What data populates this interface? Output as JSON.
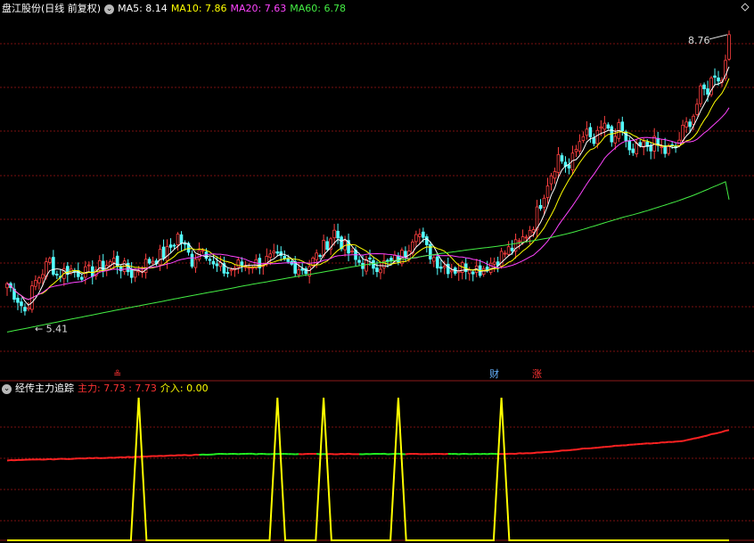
{
  "main_panel": {
    "stock_title": "盘江股份(日线 前复权)",
    "ma_legend": [
      {
        "text": "MA5: 8.14",
        "color": "#ffffff"
      },
      {
        "text": "MA10: 7.86",
        "color": "#ffff00"
      },
      {
        "text": "MA20: 7.63",
        "color": "#ff44ff"
      },
      {
        "text": "MA60: 6.78",
        "color": "#44ee44"
      }
    ],
    "high_label": "8.76",
    "low_label": "5.41",
    "markers": [
      {
        "text": "≗",
        "color": "#ff3333",
        "day": 31
      },
      {
        "text": "财",
        "color": "#66b3ff",
        "day": 137
      },
      {
        "text": "涨",
        "color": "#ff3333",
        "day": 149
      }
    ]
  },
  "indicator_panel": {
    "title": "经传主力追踪",
    "zhuli_label": "主力: 7.73 : 7.73",
    "jieru_label": "介入: 0.00",
    "colors": {
      "zhuli": "#ff3333",
      "jieru": "#ffff00"
    }
  },
  "chart_data": [
    {
      "type": "candlestick",
      "title": "盘江股份(日线 前复权)",
      "days": 204,
      "ylim": [
        4.8,
        8.95
      ],
      "price_anchors": [
        [
          0,
          5.78
        ],
        [
          3,
          5.6
        ],
        [
          5,
          5.45
        ],
        [
          8,
          5.8
        ],
        [
          12,
          6.05
        ],
        [
          14,
          5.88
        ],
        [
          17,
          5.95
        ],
        [
          22,
          5.9
        ],
        [
          25,
          5.95
        ],
        [
          30,
          6.05
        ],
        [
          35,
          5.9
        ],
        [
          40,
          6.05
        ],
        [
          45,
          6.15
        ],
        [
          48,
          6.35
        ],
        [
          52,
          6.05
        ],
        [
          55,
          6.25
        ],
        [
          58,
          5.98
        ],
        [
          62,
          5.92
        ],
        [
          65,
          6.0
        ],
        [
          70,
          6.02
        ],
        [
          75,
          6.08
        ],
        [
          80,
          6.0
        ],
        [
          84,
          5.95
        ],
        [
          88,
          6.15
        ],
        [
          92,
          6.4
        ],
        [
          95,
          6.2
        ],
        [
          98,
          6.05
        ],
        [
          102,
          6.0
        ],
        [
          108,
          6.02
        ],
        [
          112,
          6.15
        ],
        [
          115,
          6.45
        ],
        [
          118,
          6.18
        ],
        [
          122,
          6.0
        ],
        [
          126,
          5.95
        ],
        [
          130,
          6.0
        ],
        [
          133,
          5.95
        ],
        [
          137,
          6.05
        ],
        [
          140,
          6.15
        ],
        [
          144,
          6.25
        ],
        [
          148,
          6.5
        ],
        [
          152,
          7.0
        ],
        [
          155,
          7.3
        ],
        [
          158,
          7.15
        ],
        [
          162,
          7.6
        ],
        [
          165,
          7.45
        ],
        [
          168,
          7.7
        ],
        [
          170,
          7.4
        ],
        [
          172,
          7.7
        ],
        [
          175,
          7.3
        ],
        [
          178,
          7.4
        ],
        [
          182,
          7.45
        ],
        [
          185,
          7.35
        ],
        [
          188,
          7.4
        ],
        [
          190,
          7.6
        ],
        [
          193,
          7.8
        ],
        [
          195,
          8.05
        ],
        [
          197,
          8.1
        ],
        [
          199,
          8.3
        ],
        [
          201,
          8.2
        ],
        [
          203,
          8.75
        ]
      ],
      "range_high": {
        "value": 8.76,
        "day": 203
      },
      "range_low": {
        "value": 5.41,
        "day": 5
      },
      "moving_averages": [
        {
          "name": "MA5",
          "value": 8.14
        },
        {
          "name": "MA10",
          "value": 7.86
        },
        {
          "name": "MA20",
          "value": 7.63
        },
        {
          "name": "MA60",
          "value": 6.78,
          "start": 5.2
        }
      ]
    },
    {
      "type": "line",
      "title": "经传主力追踪",
      "ylim": [
        0,
        10
      ],
      "series": [
        {
          "name": "主力",
          "value": 7.73,
          "anchors": [
            [
              0,
              5.6
            ],
            [
              30,
              5.8
            ],
            [
              60,
              6.05
            ],
            [
              100,
              6.05
            ],
            [
              140,
              6.05
            ],
            [
              150,
              6.15
            ],
            [
              170,
              6.6
            ],
            [
              190,
              6.95
            ],
            [
              203,
              7.73
            ]
          ],
          "green_ranges": [
            [
              55,
              82
            ],
            [
              88,
              90
            ],
            [
              100,
              112
            ],
            [
              125,
              138
            ]
          ]
        },
        {
          "name": "介入",
          "value": 0.0,
          "spike_days": [
            37,
            76,
            89,
            110,
            139
          ],
          "spike_value": 10
        }
      ]
    }
  ]
}
